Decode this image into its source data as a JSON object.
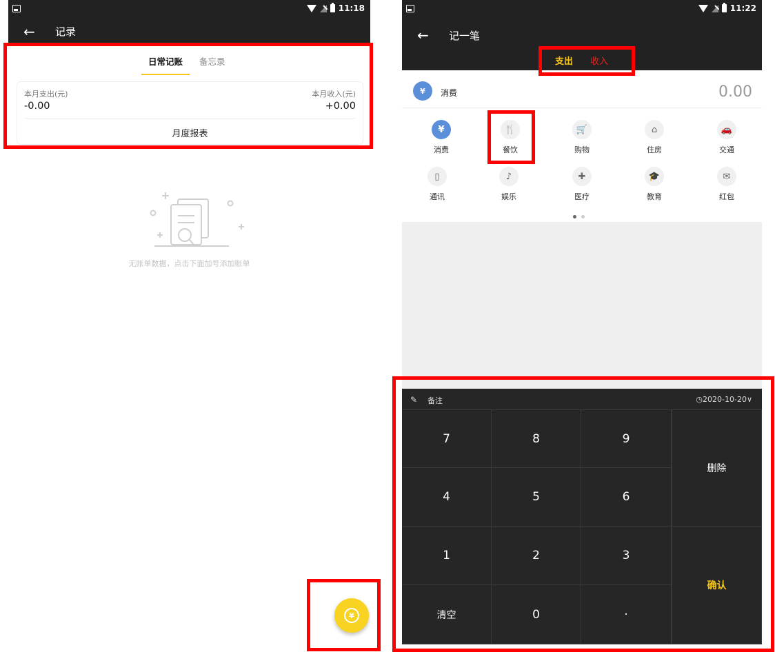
{
  "left": {
    "status": {
      "time": "11:18"
    },
    "appbar": {
      "back": "←",
      "title": "记录"
    },
    "tabs": [
      {
        "label": "日常记账"
      },
      {
        "label": "备忘录"
      }
    ],
    "summary": {
      "expense_label": "本月支出(元)",
      "expense_value": "-0.00",
      "income_label": "本月收入(元)",
      "income_value": "+0.00",
      "report_label": "月度报表"
    },
    "empty_text": "无账单数据，点击下面加号添加账单",
    "fab_icon": "yuan-icon"
  },
  "right": {
    "status": {
      "time": "11:22"
    },
    "appbar": {
      "back": "←",
      "title": "记一笔"
    },
    "type_tabs": {
      "expense": "支出",
      "income": "收入"
    },
    "selected_category": "消费",
    "amount": "0.00",
    "categories": [
      {
        "label": "消费",
        "icon": "¥"
      },
      {
        "label": "餐饮",
        "icon": "🍴"
      },
      {
        "label": "购物",
        "icon": "🛒"
      },
      {
        "label": "住房",
        "icon": "⌂"
      },
      {
        "label": "交通",
        "icon": "🚗"
      },
      {
        "label": "通讯",
        "icon": "▯"
      },
      {
        "label": "娱乐",
        "icon": "♪"
      },
      {
        "label": "医疗",
        "icon": "✚"
      },
      {
        "label": "教育",
        "icon": "🎓"
      },
      {
        "label": "红包",
        "icon": "✉"
      }
    ],
    "keypad": {
      "note_label": "备注",
      "date": "◷2020-10-20∨",
      "keys": [
        "7",
        "8",
        "9",
        "4",
        "5",
        "6",
        "1",
        "2",
        "3",
        "清空",
        "0",
        "·"
      ],
      "delete": "删除",
      "confirm": "确认"
    }
  },
  "colors": {
    "accent": "#f5c518",
    "income": "#e5251e",
    "highlight": "#ff0000",
    "category_active": "#5b8fd9"
  }
}
